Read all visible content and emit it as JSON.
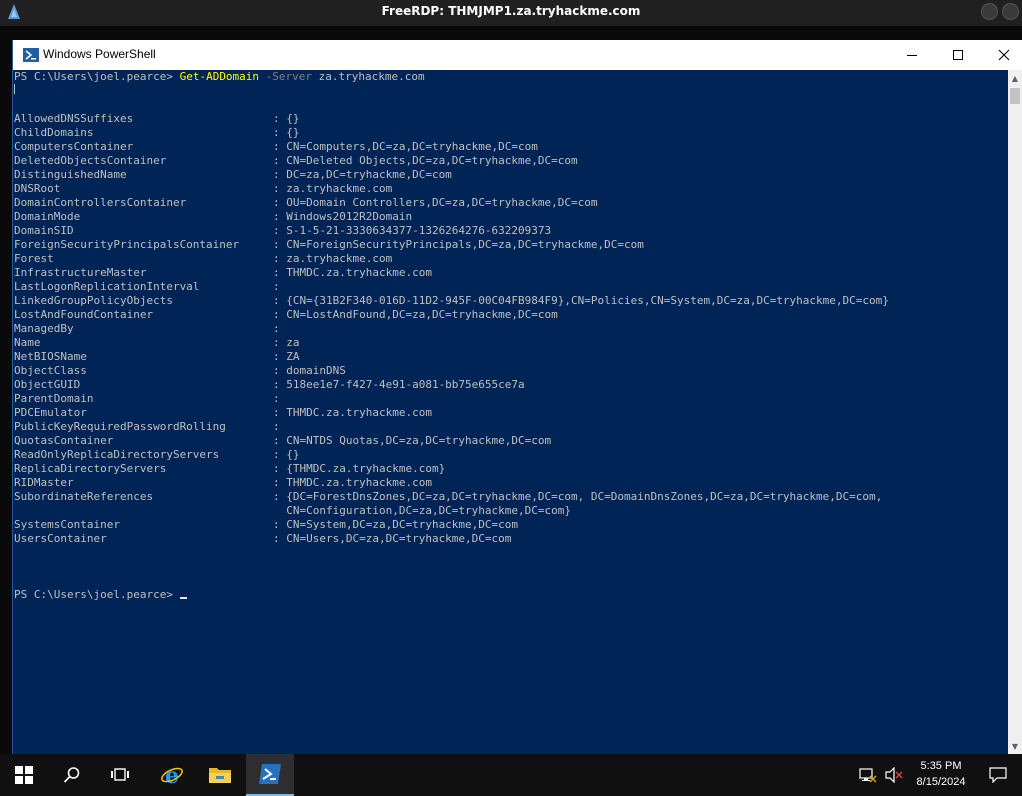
{
  "rdp": {
    "title": "FreeRDP: THMJMP1.za.tryhackme.com"
  },
  "window": {
    "title": "Windows PowerShell"
  },
  "console": {
    "prompt": "PS C:\\Users\\joel.pearce>",
    "command": "Get-ADDomain",
    "param": "-Server",
    "arg": "za.tryhackme.com",
    "properties": [
      {
        "name": "AllowedDNSSuffixes",
        "value": ": {}"
      },
      {
        "name": "ChildDomains",
        "value": ": {}"
      },
      {
        "name": "ComputersContainer",
        "value": ": CN=Computers,DC=za,DC=tryhackme,DC=com"
      },
      {
        "name": "DeletedObjectsContainer",
        "value": ": CN=Deleted Objects,DC=za,DC=tryhackme,DC=com"
      },
      {
        "name": "DistinguishedName",
        "value": ": DC=za,DC=tryhackme,DC=com"
      },
      {
        "name": "DNSRoot",
        "value": ": za.tryhackme.com"
      },
      {
        "name": "DomainControllersContainer",
        "value": ": OU=Domain Controllers,DC=za,DC=tryhackme,DC=com"
      },
      {
        "name": "DomainMode",
        "value": ": Windows2012R2Domain"
      },
      {
        "name": "DomainSID",
        "value": ": S-1-5-21-3330634377-1326264276-632209373"
      },
      {
        "name": "ForeignSecurityPrincipalsContainer",
        "value": ": CN=ForeignSecurityPrincipals,DC=za,DC=tryhackme,DC=com"
      },
      {
        "name": "Forest",
        "value": ": za.tryhackme.com"
      },
      {
        "name": "InfrastructureMaster",
        "value": ": THMDC.za.tryhackme.com"
      },
      {
        "name": "LastLogonReplicationInterval",
        "value": ":"
      },
      {
        "name": "LinkedGroupPolicyObjects",
        "value": ": {CN={31B2F340-016D-11D2-945F-00C04FB984F9},CN=Policies,CN=System,DC=za,DC=tryhackme,DC=com}"
      },
      {
        "name": "LostAndFoundContainer",
        "value": ": CN=LostAndFound,DC=za,DC=tryhackme,DC=com"
      },
      {
        "name": "ManagedBy",
        "value": ":"
      },
      {
        "name": "Name",
        "value": ": za"
      },
      {
        "name": "NetBIOSName",
        "value": ": ZA"
      },
      {
        "name": "ObjectClass",
        "value": ": domainDNS"
      },
      {
        "name": "ObjectGUID",
        "value": ": 518ee1e7-f427-4e91-a081-bb75e655ce7a"
      },
      {
        "name": "ParentDomain",
        "value": ":"
      },
      {
        "name": "PDCEmulator",
        "value": ": THMDC.za.tryhackme.com"
      },
      {
        "name": "PublicKeyRequiredPasswordRolling",
        "value": ":"
      },
      {
        "name": "QuotasContainer",
        "value": ": CN=NTDS Quotas,DC=za,DC=tryhackme,DC=com"
      },
      {
        "name": "ReadOnlyReplicaDirectoryServers",
        "value": ": {}"
      },
      {
        "name": "ReplicaDirectoryServers",
        "value": ": {THMDC.za.tryhackme.com}"
      },
      {
        "name": "RIDMaster",
        "value": ": THMDC.za.tryhackme.com"
      },
      {
        "name": "SubordinateReferences",
        "value": ": {DC=ForestDnsZones,DC=za,DC=tryhackme,DC=com, DC=DomainDnsZones,DC=za,DC=tryhackme,DC=com,"
      },
      {
        "name": "",
        "value": "  CN=Configuration,DC=za,DC=tryhackme,DC=com}"
      },
      {
        "name": "SystemsContainer",
        "value": ": CN=System,DC=za,DC=tryhackme,DC=com"
      },
      {
        "name": "UsersContainer",
        "value": ": CN=Users,DC=za,DC=tryhackme,DC=com"
      }
    ]
  },
  "taskbar": {
    "time": "5:35 PM",
    "date": "8/15/2024",
    "icons": [
      "windows-start-icon",
      "search-icon",
      "task-view-icon",
      "internet-explorer-icon",
      "file-explorer-icon",
      "powershell-icon"
    ]
  },
  "colors": {
    "console_bg": "#012456",
    "command": "#ffff00",
    "param": "#808080",
    "text": "#c0c0c0"
  }
}
